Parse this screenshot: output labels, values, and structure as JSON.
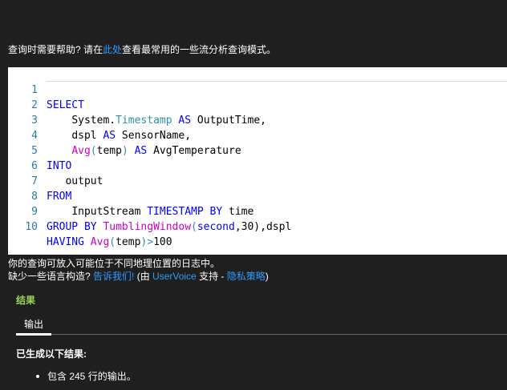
{
  "help": {
    "prefix": "查询时需要帮助? 请在",
    "link": "此处",
    "suffix": "查看最常用的一些流分析查询模式。"
  },
  "editor": {
    "line_numbers": [
      "1",
      "2",
      "3",
      "4",
      "5",
      "6",
      "7",
      "8",
      "9",
      "10"
    ],
    "lines": {
      "l1": {
        "kw": "SELECT"
      },
      "l2": {
        "indent": "    ",
        "a": "System",
        "dot": ".",
        "b": "Timestamp",
        "c": " ",
        "kw": "AS",
        "d": " OutputTime,"
      },
      "l3": {
        "indent": "    ",
        "a": "dspl ",
        "kw": "AS",
        "b": " SensorName,"
      },
      "l4": {
        "indent": "    ",
        "fn": "Avg",
        "a": "(",
        "b": "temp",
        "c": ") ",
        "kw": "AS",
        "d": " AvgTemperature"
      },
      "l5": {
        "kw": "INTO"
      },
      "l6": {
        "indent": "   ",
        "a": "output"
      },
      "l7": {
        "kw": "FROM"
      },
      "l8": {
        "indent": "    ",
        "a": "InputStream ",
        "kw1": "TIMESTAMP",
        "b": " ",
        "kw2": "BY",
        "c": " time"
      },
      "l9": {
        "kw1": "GROUP",
        "a": " ",
        "kw2": "BY",
        "b": " ",
        "fn": "TumblingWindow",
        "c": "(",
        "kw3": "second",
        "d": ",30),dspl"
      },
      "l10": {
        "kw": "HAVING",
        "a": " ",
        "fn": "Avg",
        "b": "(",
        "c": "temp",
        "d": ")",
        "e": ">",
        "f": "100"
      }
    }
  },
  "status": {
    "line1": "你的查询可放入可能位于不同地理位置的日志中。",
    "line2_prefix": "缺少一些语言构造? ",
    "line2_link1": "告诉我们!",
    "line2_mid": " (由 ",
    "line2_link2": "UserVoice",
    "line2_mid2": " 支持 - ",
    "line2_link3": "隐私策略",
    "line2_suffix": ")"
  },
  "results": {
    "title": "结果",
    "tab_output": "输出",
    "generated": "已生成以下结果:",
    "items": [
      "包含 245 行的输出。"
    ]
  },
  "colors": {
    "link": "#2d9cff",
    "results_title": "#9bd35a",
    "keyword": "#0000ff",
    "function": "#c800c8",
    "line_number": "#2b7ba9"
  }
}
